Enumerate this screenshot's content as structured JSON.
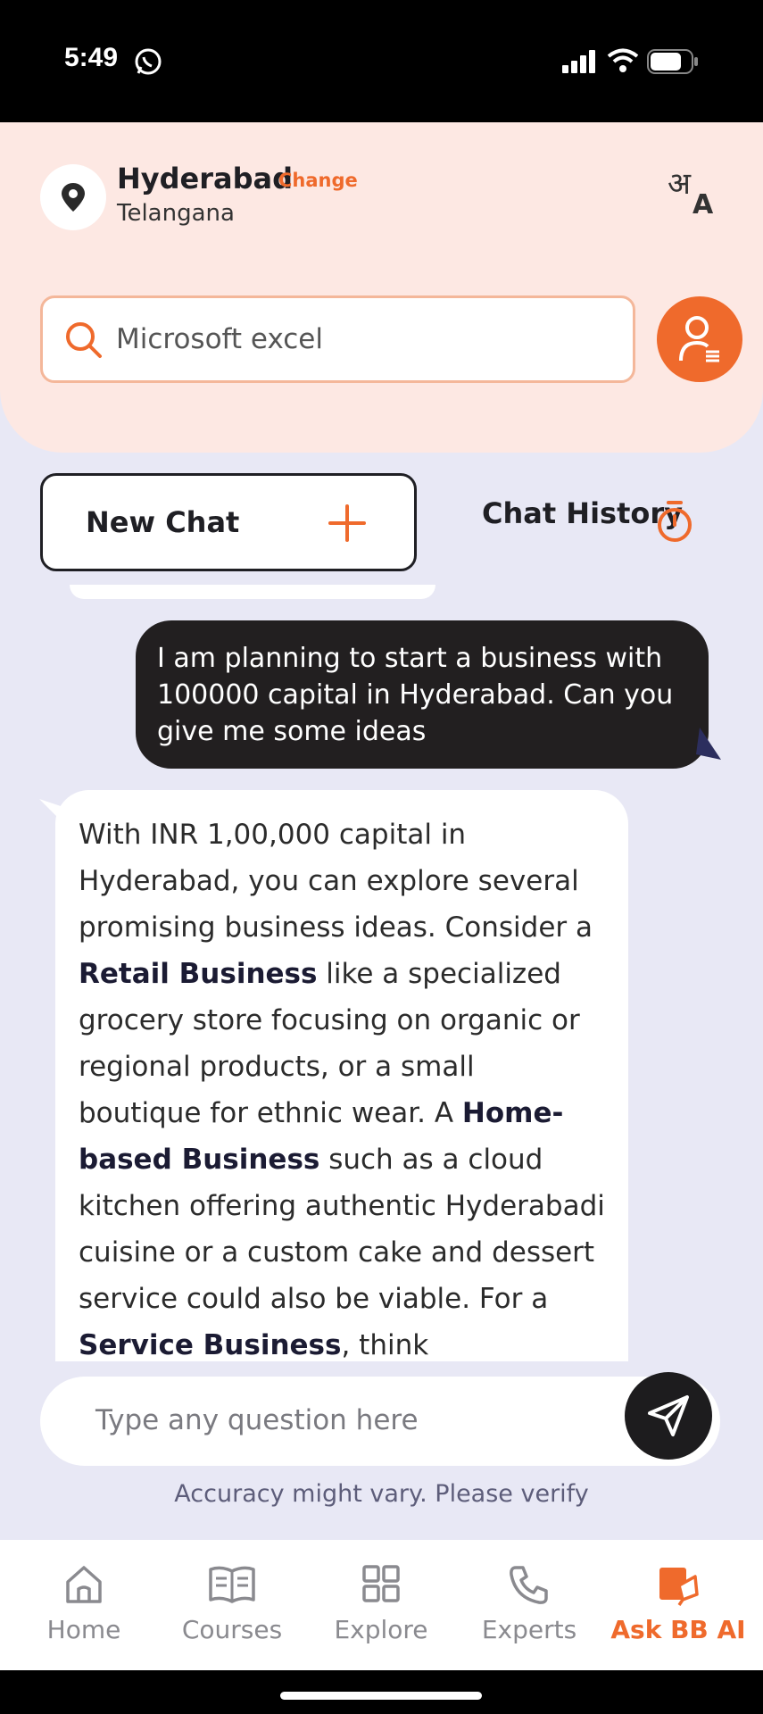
{
  "status_bar": {
    "time": "5:49"
  },
  "location": {
    "city": "Hyderabad",
    "change_label": "Change",
    "state": "Telangana"
  },
  "search": {
    "value": "Microsoft excel"
  },
  "chat_actions": {
    "new_chat_label": "New Chat",
    "history_label": "Chat History"
  },
  "messages": {
    "user_message": "I am planning to start a business with 100000 capital in Hyderabad. Can you give me some ideas",
    "bot_reply": {
      "p1": "With INR 1,00,000 capital in Hyderabad, you can explore several promising business ideas. Consider a ",
      "b1": "Retail Business",
      "p2": " like a specialized grocery store focusing on organic or regional products, or a small boutique for ethnic wear. A ",
      "b2": "Home-based Business",
      "p3": " such as a cloud kitchen offering authentic Hyderabadi cuisine or a custom cake and dessert service could also be viable. For a ",
      "b3": "Service Business",
      "p4": ", think"
    }
  },
  "input": {
    "placeholder": "Type any question here"
  },
  "disclaimer": "Accuracy might vary. Please verify",
  "bottom_nav": {
    "items": [
      {
        "label": "Home",
        "icon": "home-icon"
      },
      {
        "label": "Courses",
        "icon": "book-icon"
      },
      {
        "label": "Explore",
        "icon": "grid-icon"
      },
      {
        "label": "Experts",
        "icon": "phone-icon"
      },
      {
        "label": "Ask BB AI",
        "icon": "ask-ai-icon",
        "active": true
      }
    ]
  },
  "colors": {
    "accent": "#ef6a2c",
    "header_bg": "#fde8e3",
    "page_bg": "#e8e8f5",
    "user_bubble": "#221f20"
  }
}
